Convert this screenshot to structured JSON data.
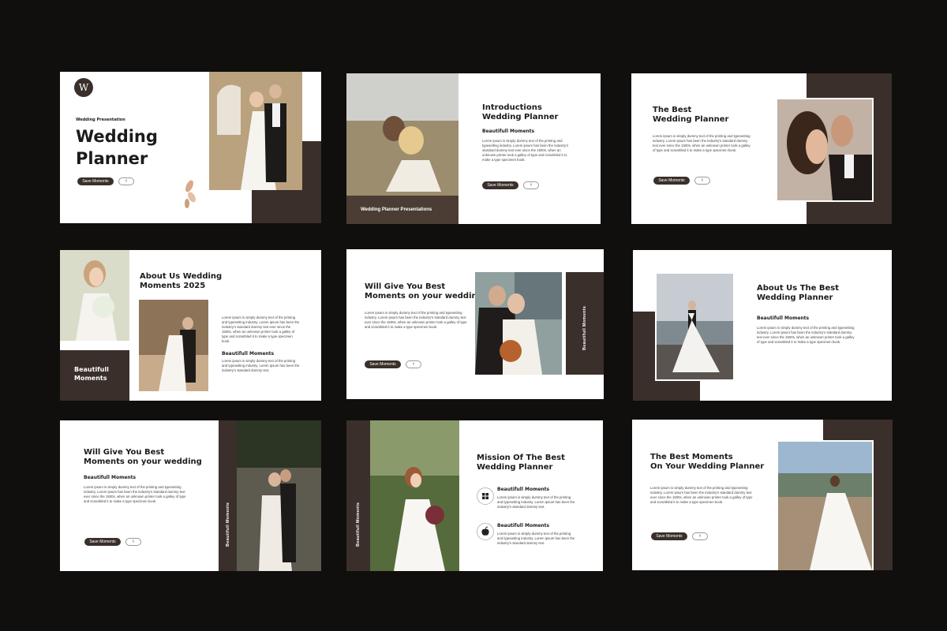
{
  "colors": {
    "background": "#100f0d",
    "brown": "#3a2f2a",
    "slide": "#ffffff"
  },
  "lorem_a": "Lorem ipsum is simply dummy text of the printing and typesetting industry. Lorem ipsum has been the industry's standard dummy text ever since the 1500s, when an unknown printer took a galley of type and scrambled it to make a type specimen book.",
  "lorem_b": "Lorem ipsum is simply dummy text of the printing and typesetting industry. Lorem ipsum has been the industry's standard dummy text.",
  "s1": {
    "logo": "W",
    "small": "Wedding Presentation",
    "title": "Wedding\nPlanner",
    "button": "Save Moments",
    "arrow": "‹"
  },
  "s2": {
    "title": "Introductions\nWedding Planner",
    "sub": "Beautifull Moments",
    "caption": "Wedding Planner Presentations",
    "button": "Save Moments",
    "arrow": "‹"
  },
  "s3": {
    "title": "The Best\nWedding Planner",
    "button": "Save Moments",
    "arrow": "‹"
  },
  "s4": {
    "title": "About Us Wedding\nMoments 2025",
    "sub": "Beautifull Moments",
    "box": "Beautifull\nMoments"
  },
  "s5": {
    "title": "Will Give You Best\nMoments on your wedding",
    "button": "Save Moments",
    "arrow": "‹",
    "vertical": "Beautifull Moments"
  },
  "s6": {
    "title": "About Us The Best\nWedding Planner",
    "sub": "Beautifull Moments"
  },
  "s7": {
    "title": "Will Give You Best\nMoments on your wedding",
    "sub": "Beautifull Moments",
    "button": "Save Moments",
    "arrow": "‹",
    "vertical": "Beautifull Moments"
  },
  "s8": {
    "title": "Mission Of The Best\nWedding Planner",
    "sub1": "Beautifull Moments",
    "sub2": "Beautifull Moments",
    "vertical": "Beautifull Moments",
    "icon1": "windows-icon",
    "icon2": "apple-icon"
  },
  "s9": {
    "title": "The Best Moments\nOn Your Wedding Planner",
    "button": "Save Moments",
    "arrow": "‹"
  }
}
